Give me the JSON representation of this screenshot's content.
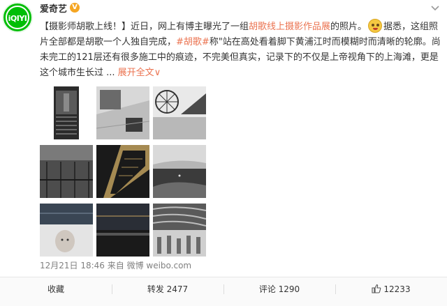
{
  "user": {
    "name": "爱奇艺",
    "avatar_text": "iQIYI",
    "verified_mark": "V"
  },
  "post": {
    "seg1": "【摄影师胡歌上线！】近日，网上有博主曝光了一组",
    "link": "胡歌线上摄影作品展",
    "seg2": "的照片。",
    "seg3": "据悉，这组照片全部都是胡歌一个人独自完成，",
    "tag": "#胡歌#",
    "seg4": "称\"站在高处看着脚下黄浦江时而模糊时而清晰的轮廓。尚未完工的121层还有很多施工中的痕迹，不完美但真实，记录下的不仅是上帝视角下的上海滩，更是这个城市生长过 ... ",
    "more": "展开全文",
    "more_arrow": "∨"
  },
  "gallery": {
    "count": 9,
    "images": [
      "photo-1",
      "photo-2",
      "photo-3",
      "photo-4",
      "photo-5",
      "photo-6",
      "photo-7",
      "photo-8",
      "photo-9"
    ]
  },
  "meta": {
    "date": "12月21日 18:46",
    "source": "来自 微博 weibo.com"
  },
  "footer": {
    "collect": "收藏",
    "forward": "转发 2477",
    "comment": "评论 1290",
    "like": "12233"
  },
  "colors": {
    "brand": "#00be06",
    "link": "#eb7350",
    "meta": "#808080"
  },
  "icons": [
    "verified-badge-icon",
    "chevron-down-icon",
    "smile-emoji-icon",
    "like-thumbs-up-icon"
  ]
}
